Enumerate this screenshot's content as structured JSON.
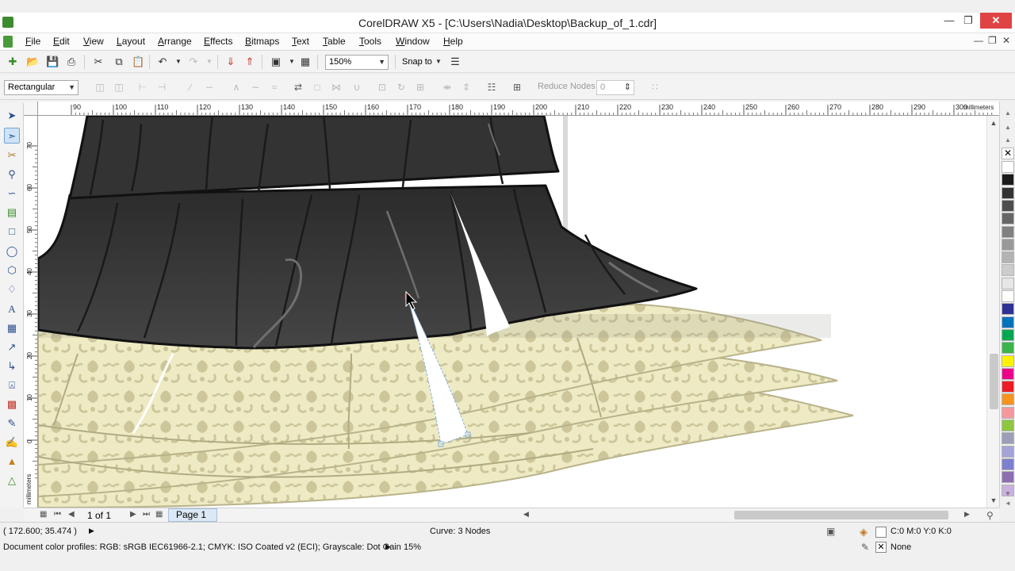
{
  "window": {
    "title": "CorelDRAW X5 - [C:\\Users\\Nadia\\Desktop\\Backup_of_1.cdr]",
    "minimize_icon": "minimize-icon",
    "maximize_icon": "restore-icon",
    "close_icon": "close-icon"
  },
  "menu": {
    "items": [
      "File",
      "Edit",
      "View",
      "Layout",
      "Arrange",
      "Effects",
      "Bitmaps",
      "Text",
      "Table",
      "Tools",
      "Window",
      "Help"
    ]
  },
  "standard_toolbar": {
    "zoom_value": "150%",
    "snap_label": "Snap to"
  },
  "property_bar": {
    "selection_mode": "Rectangular",
    "reduce_nodes_label": "Reduce Nodes",
    "reduce_nodes_value": "0"
  },
  "rulers": {
    "horizontal_ticks": [
      "90",
      "100",
      "110",
      "120",
      "130",
      "140",
      "150",
      "160",
      "170",
      "180",
      "190",
      "200",
      "210",
      "220",
      "230",
      "240",
      "250",
      "260",
      "270",
      "280",
      "290",
      "300"
    ],
    "horizontal_unit": "millimeters",
    "vertical_ticks": [
      "70",
      "60",
      "50",
      "40",
      "30",
      "20",
      "10",
      "0"
    ],
    "vertical_unit": "millimeters"
  },
  "page_nav": {
    "page_count": "1 of 1",
    "page_tab": "Page 1"
  },
  "status": {
    "coordinates": "( 172.600; 35.474 )",
    "selection_info": "Curve: 3 Nodes",
    "fill_info": "C:0 M:0 Y:0 K:0",
    "outline_info": "None",
    "color_profiles": "Document color profiles: RGB: sRGB IEC61966-2.1; CMYK: ISO Coated v2 (ECI); Grayscale: Dot Gain 15%"
  },
  "palette": {
    "colors": [
      "#ffffff",
      "#1a1a1a",
      "#333333",
      "#4d4d4d",
      "#666666",
      "#808080",
      "#999999",
      "#b3b3b3",
      "#cccccc",
      "#e6e6e6",
      "#ffffff",
      "#2e3192",
      "#0072bc",
      "#00a651",
      "#39b54a",
      "#fff200",
      "#ec008c",
      "#ed1c24",
      "#f7941d",
      "#f5989d",
      "#8dc63f",
      "#9e9eb8",
      "#a3a3d6",
      "#7f7fcf",
      "#8c6fb0",
      "#c7b2de"
    ]
  },
  "colors": {
    "skirt_dark": "#3a3a3a",
    "skirt_light": "#eeebc4",
    "pattern": "#c9c296",
    "accent_selected": "#7fb0e0"
  }
}
